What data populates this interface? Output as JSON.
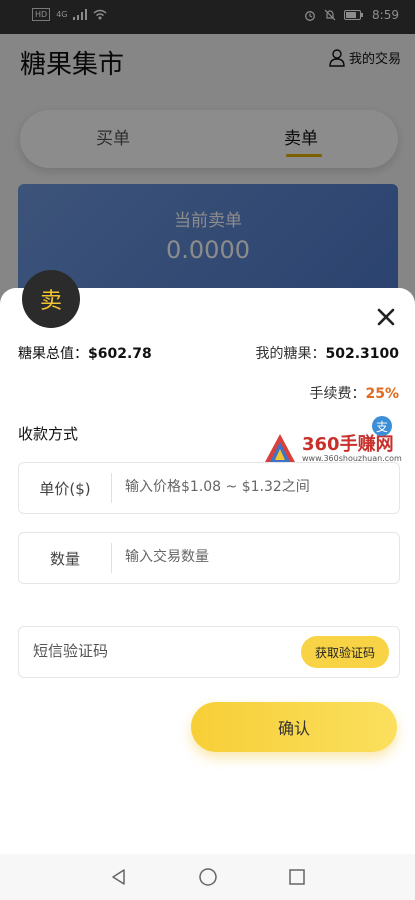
{
  "status_bar": {
    "chip": "HD",
    "network": "4G",
    "time": "8:59"
  },
  "app": {
    "title": "糖果集市",
    "my_trades": "我的交易",
    "tabs": [
      "买单",
      "卖单"
    ],
    "current_sell_label": "当前卖单",
    "current_sell_value": "0.0000"
  },
  "sheet": {
    "badge": "卖",
    "total_label": "糖果总值：",
    "total_value": "$602.78",
    "mine_label": "我的糖果：",
    "mine_value": "502.3100",
    "fee_label": "手续费：",
    "fee_value": "25%",
    "payment_label": "收款方式",
    "price_label": "单价($)",
    "price_placeholder": "输入价格$1.08 ~ $1.32之间",
    "quantity_label": "数量",
    "quantity_placeholder": "输入交易数量",
    "sms_placeholder": "短信验证码",
    "sms_button": "获取验证码",
    "confirm_button": "确认"
  },
  "watermark": {
    "brand": "360手赚网",
    "url": "www.360shouzhuan.com",
    "pay_icon": "支"
  },
  "colors": {
    "accent": "#f7d345",
    "fee": "#e06a1f",
    "badge_bg": "#2b2b2b",
    "card": "#5b86d2"
  }
}
